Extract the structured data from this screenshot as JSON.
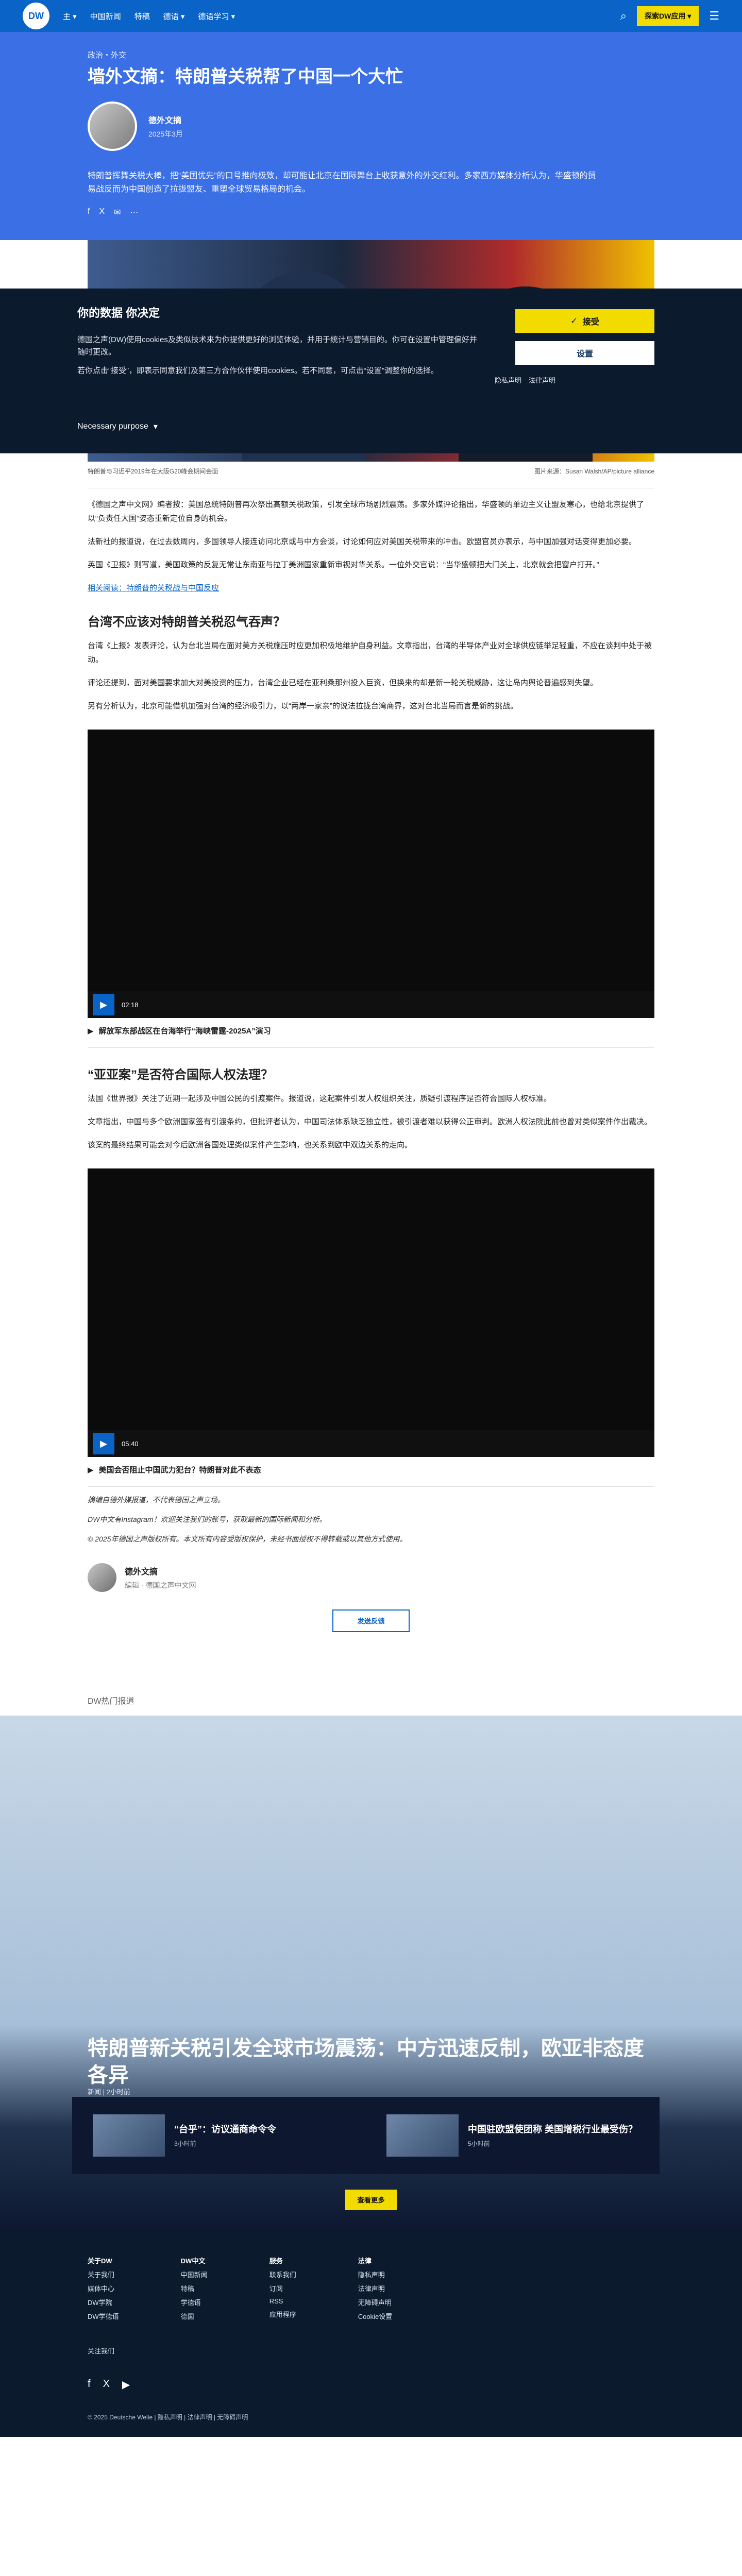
{
  "header": {
    "logo": "DW",
    "nav": [
      "主 ▾",
      "中国新闻",
      "特稿",
      "德语 ▾",
      "德语学习 ▾"
    ],
    "yellow_btn": "探索DW应用 ▾",
    "search_icon": "search-icon",
    "menu_icon": "menu-icon"
  },
  "hero": {
    "kicker": "政治・外交",
    "title": "墙外文摘：特朗普关税帮了中国一个大忙",
    "author": "德外文摘",
    "date": "2025年3月",
    "lead": "特朗普挥舞关税大棒，把“美国优先”的口号推向极致，却可能让北京在国际舞台上收获意外的外交红利。多家西方媒体分析认为，华盛顿的贸易战反而为中国创造了拉拢盟友、重塑全球贸易格局的机会。",
    "share": [
      "f",
      "X",
      "✉",
      "⋯"
    ]
  },
  "consent": {
    "title": "你的数据 你决定",
    "p1": "德国之声(DW)使用cookies及类似技术来为你提供更好的浏览体验，并用于统计与营销目的。你可在设置中管理偏好并随时更改。",
    "p2": "若你点击“接受”，即表示同意我们及第三方合作伙伴使用cookies。若不同意，可点击“设置”调整你的选择。",
    "accept": "接受",
    "settings": "设置",
    "links": [
      "隐私声明",
      "法律声明"
    ],
    "necessary": "Necessary purpose",
    "chevron": "▾"
  },
  "article": {
    "photo_caption": "特朗普与习近平2019年在大阪G20峰会期间会面",
    "photo_credit": "图片来源：Susan Walsh/AP/picture alliance",
    "p1": "《德国之声中文网》编者按：美国总统特朗普再次祭出高额关税政策，引发全球市场剧烈震荡。多家外媒评论指出，华盛顿的单边主义让盟友寒心，也给北京提供了以“负责任大国”姿态重新定位自身的机会。",
    "p2": "法新社的报道说，在过去数周内，多国领导人接连访问北京或与中方会谈，讨论如何应对美国关税带来的冲击。欧盟官员亦表示，与中国加强对话变得更加必要。",
    "p3": "英国《卫报》则写道，美国政策的反复无常让东南亚与拉丁美洲国家重新审视对华关系。一位外交官说：“当华盛顿把大门关上，北京就会把窗户打开。”",
    "link_text": "相关阅读：特朗普的关税战与中国反应",
    "h1": "台湾不应该对特朗普关税忍气吞声？",
    "p4": "台湾《上报》发表评论，认为台北当局在面对美方关税施压时应更加积极地维护自身利益。文章指出，台湾的半导体产业对全球供应链举足轻重，不应在谈判中处于被动。",
    "p5": "评论还提到，面对美国要求加大对美投资的压力，台湾企业已经在亚利桑那州投入巨资，但换来的却是新一轮关税威胁，这让岛内舆论普遍感到失望。",
    "p6": "另有分析认为，北京可能借机加强对台湾的经济吸引力，以“两岸一家亲”的说法拉拢台湾商界，这对台北当局而言是新的挑战。",
    "video1_caption": "解放军东部战区在台海举行“海峡雷霆-2025A”演习",
    "video1_time": "02:18",
    "h2": "“亚亚案”是否符合国际人权法理？",
    "p7": "法国《世界报》关注了近期一起涉及中国公民的引渡案件。报道说，这起案件引发人权组织关注，质疑引渡程序是否符合国际人权标准。",
    "p8": "文章指出，中国与多个欧洲国家签有引渡条约，但批评者认为，中国司法体系缺乏独立性，被引渡者难以获得公正审判。欧洲人权法院此前也曾对类似案件作出裁决。",
    "p9": "该案的最终结果可能会对今后欧洲各国处理类似案件产生影响，也关系到欧中双边关系的走向。",
    "video2_caption": "美国会否阻止中国武力犯台？特朗普对此不表态",
    "video2_time": "05:40",
    "note1": "摘编自德外媒报道，不代表德国之声立场。",
    "note2": "DW中文有Instagram！欢迎关注我们的账号，获取最新的国际新闻和分析。",
    "note3": "© 2025年德国之声版权所有。本文所有内容受版权保护，未经书面授权不得转载或以其他方式使用。",
    "author_name": "德外文摘",
    "author_sub": "编辑 · 德国之声中文网",
    "ad_btn": "发送反馈"
  },
  "teaser": {
    "section": "DW热门报道",
    "title": "特朗普新关税引发全球市场震荡：中方迅速反制，欧亚非态度各异",
    "meta": "新闻 | 2小时前",
    "cards": [
      {
        "title": "“台乎”：访议通商命令令",
        "time": "3小时前"
      },
      {
        "title": "中国驻欧盟使团称 美国增税行业最受伤？",
        "time": "5小时前"
      }
    ],
    "more_btn": "查看更多"
  },
  "footer": {
    "cols": [
      {
        "head": "关于DW",
        "items": [
          "关于我们",
          "媒体中心",
          "DW学院",
          "DW学德语"
        ]
      },
      {
        "head": "DW中文",
        "items": [
          "中国新闻",
          "特稿",
          "学德语",
          "德国"
        ]
      },
      {
        "head": "服务",
        "items": [
          "联系我们",
          "订阅",
          "RSS",
          "应用程序"
        ]
      },
      {
        "head": "法律",
        "items": [
          "隐私声明",
          "法律声明",
          "无障碍声明",
          "Cookie设置"
        ]
      }
    ],
    "follow": "关注我们",
    "social": [
      "f",
      "X",
      "▶"
    ],
    "copyright": "© 2025 Deutsche Welle | 隐私声明 | 法律声明 | 无障碍声明"
  }
}
